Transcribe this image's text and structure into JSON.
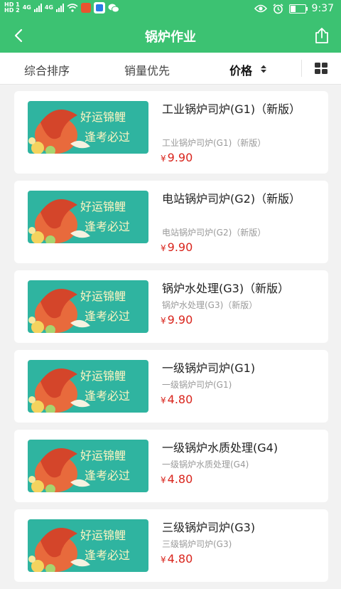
{
  "status_bar": {
    "hd1": "HD 1",
    "hd2": "HD 2",
    "net1": "4G",
    "net2": "4G",
    "time": "9:37",
    "battery_level": 0.35
  },
  "header": {
    "title": "锅炉作业"
  },
  "sort": {
    "comprehensive": "综合排序",
    "sales": "销量优先",
    "price": "价格"
  },
  "thumb_text": {
    "line1": "好运锦鲤",
    "line2": "逢考必过"
  },
  "colors": {
    "brand": "#3cc272",
    "price": "#d9251d"
  },
  "products": [
    {
      "name": "工业锅炉司炉(G1)（新版）",
      "subtitle": "工业锅炉司炉(G1)（新版）",
      "currency": "¥",
      "price": "9.90"
    },
    {
      "name": "电站锅炉司炉(G2)（新版）",
      "subtitle": "电站锅炉司炉(G2)（新版）",
      "currency": "¥",
      "price": "9.90"
    },
    {
      "name": "锅炉水处理(G3)（新版）",
      "subtitle": "锅炉水处理(G3)（新版）",
      "currency": "¥",
      "price": "9.90"
    },
    {
      "name": "一级锅炉司炉(G1)",
      "subtitle": "一级锅炉司炉(G1)",
      "currency": "¥",
      "price": "4.80"
    },
    {
      "name": "一级锅炉水质处理(G4)",
      "subtitle": "一级锅炉水质处理(G4)",
      "currency": "¥",
      "price": "4.80"
    },
    {
      "name": "三级锅炉司炉(G3)",
      "subtitle": "三级锅炉司炉(G3)",
      "currency": "¥",
      "price": "4.80"
    }
  ]
}
